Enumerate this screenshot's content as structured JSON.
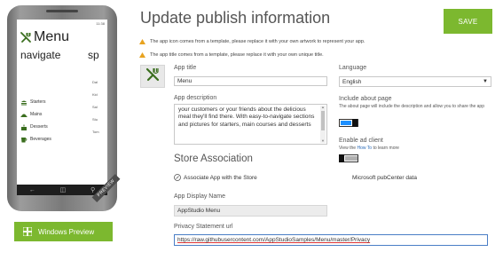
{
  "colors": {
    "accent_green": "#7cb82f",
    "toggle_on_blue": "#1e90ff",
    "toggle_off_gray": "#b0b0b0",
    "link_blue": "#2a6ab7",
    "warning_orange": "#e8a320"
  },
  "phone": {
    "status_text": "11:38",
    "app_title": "Menu",
    "nav_header": "navigate",
    "nav_peek": "sp",
    "nav_items": [
      {
        "label": "Starters",
        "icon": "burger-icon"
      },
      {
        "label": "Mains",
        "icon": "dish-icon"
      },
      {
        "label": "Desserts",
        "icon": "cake-icon"
      },
      {
        "label": "Beverages",
        "icon": "cup-icon"
      }
    ],
    "peek_items": [
      "Dal",
      "Kid",
      "Sal",
      "Stu",
      "Tom"
    ],
    "preview_ribbon": "PREVIEW"
  },
  "windows_preview_button": {
    "label": "Windows Preview",
    "icon": "windows-logo-icon"
  },
  "header": {
    "title": "Update publish information",
    "save_label": "SAVE"
  },
  "warnings": [
    "The app icon comes from a template, please replace it with your own artwork to represent your app.",
    "The app title comes from a template, please replace it with your own unique title."
  ],
  "form": {
    "app_title_label": "App title",
    "app_title_value": "Menu",
    "app_description_label": "App description",
    "app_description_value": "your customers or your friends about the delicious meal they'll find there. With easy-to-navigate sections and pictures for starters, main courses and desserts",
    "store_association_title": "Store Association",
    "associate_link_label": "Associate App with the Store",
    "display_name_label": "App Display Name",
    "display_name_value": "AppStudio Menu",
    "privacy_url_label": "Privacy Statement url",
    "privacy_url_value": "https://raw.githubusercontent.com/AppStudioSamples/Menu/master/Privacy"
  },
  "settings": {
    "language_label": "Language",
    "language_value": "English",
    "include_about_label": "Include about page",
    "include_about_note": "The about page will include the description and allow you to share the app",
    "include_about_on": true,
    "ad_client_label": "Enable ad client",
    "ad_client_note_prefix": "View the ",
    "ad_client_link": "How To",
    "ad_client_note_suffix": " to learn more",
    "ad_client_on": false,
    "pubcenter_text": "Microsoft pubCenter data"
  }
}
